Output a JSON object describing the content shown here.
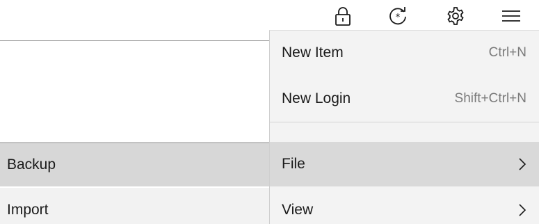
{
  "toolbar": {
    "lock_icon": "lock-icon",
    "sync_icon": "sync-icon",
    "settings_icon": "gear-icon",
    "menu_icon": "hamburger-menu-icon"
  },
  "background": {
    "items": [
      {
        "label": "Backup",
        "highlighted": true
      },
      {
        "label": "Import",
        "highlighted": false
      }
    ]
  },
  "menu": {
    "items": [
      {
        "label": "New Item",
        "shortcut": "Ctrl+N"
      },
      {
        "label": "New Login",
        "shortcut": "Shift+Ctrl+N"
      },
      {
        "label": "File",
        "submenu": true,
        "highlighted": true
      },
      {
        "label": "View",
        "submenu": true
      }
    ]
  },
  "colors": {
    "menu_bg": "#f3f3f3",
    "highlight": "#d9d9d9",
    "shortcut_text": "#7a7a7a"
  }
}
